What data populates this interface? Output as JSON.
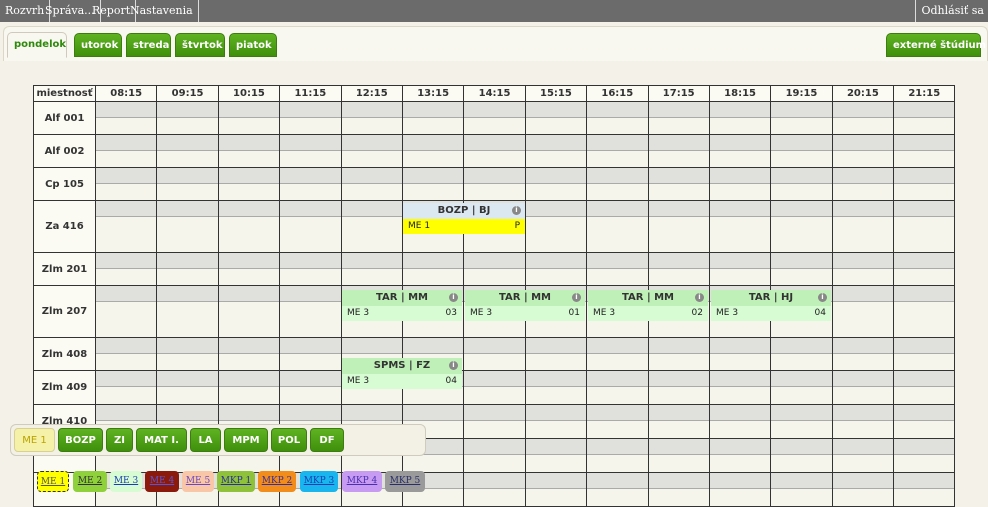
{
  "menu": {
    "items": [
      "Rozvrh",
      "Správa...",
      "Report",
      "Nastavenia"
    ],
    "logout": "Odhlásiť sa"
  },
  "days": [
    "pondelok",
    "utorok",
    "streda",
    "štvrtok",
    "piatok"
  ],
  "active_day": "pondelok",
  "external_tab": "externé štúdium",
  "grid": {
    "corner": "miestnosť",
    "times": [
      "08:15",
      "09:15",
      "10:15",
      "11:15",
      "12:15",
      "13:15",
      "14:15",
      "15:15",
      "16:15",
      "17:15",
      "18:15",
      "19:15",
      "20:15",
      "21:15"
    ],
    "rooms": [
      "Alf 001",
      "Alf 002",
      "Cp 105",
      "Za 416",
      "Zlm 201",
      "Zlm 207",
      "Zlm 408",
      "Zlm 409",
      "Zlm 410",
      "",
      ""
    ]
  },
  "events": [
    {
      "title": "BOZP | BJ",
      "group": "ME 1",
      "num": "P",
      "head_color": "#dbe8f2",
      "body_color": "#ffff00"
    },
    {
      "title": "TAR | MM",
      "group": "ME 3",
      "num": "03",
      "head_color": "#bff0b8",
      "body_color": "#d7fbd2"
    },
    {
      "title": "TAR | MM",
      "group": "ME 3",
      "num": "01",
      "head_color": "#bff0b8",
      "body_color": "#d7fbd2"
    },
    {
      "title": "TAR | MM",
      "group": "ME 3",
      "num": "02",
      "head_color": "#bff0b8",
      "body_color": "#d7fbd2"
    },
    {
      "title": "TAR | HJ",
      "group": "ME 3",
      "num": "04",
      "head_color": "#bff0b8",
      "body_color": "#d7fbd2"
    },
    {
      "title": "SPMS | FZ",
      "group": "ME 3",
      "num": "04",
      "head_color": "#bff0b8",
      "body_color": "#d7fbd2"
    }
  ],
  "info_icon": "i",
  "subject_tabs": [
    "ME 1",
    "BOZP",
    "ZI",
    "MAT I.",
    "LA",
    "MPM",
    "POL",
    "DF"
  ],
  "active_subject": "ME 1",
  "groups": [
    {
      "label": "ME 1",
      "bg": "#ffff00",
      "fg": "#555555"
    },
    {
      "label": "ME 2",
      "bg": "#8fd13b",
      "fg": "#333333"
    },
    {
      "label": "ME 3",
      "bg": "#d7fbd2",
      "fg": "#1a3fb0"
    },
    {
      "label": "ME 4",
      "bg": "#8b1a0c",
      "fg": "#5a55d8"
    },
    {
      "label": "ME 5",
      "bg": "#f9c7a8",
      "fg": "#6b46c1"
    },
    {
      "label": "MKP 1",
      "bg": "#8fc23a",
      "fg": "#2a2f9a"
    },
    {
      "label": "MKP 2",
      "bg": "#f28c1a",
      "fg": "#3a2f9a"
    },
    {
      "label": "MKP 3",
      "bg": "#18b5ef",
      "fg": "#1a3fb0"
    },
    {
      "label": "MKP 4",
      "bg": "#c89bf2",
      "fg": "#4a2fb0"
    },
    {
      "label": "MKP 5",
      "bg": "#9a9a9a",
      "fg": "#2a2f6a"
    }
  ]
}
